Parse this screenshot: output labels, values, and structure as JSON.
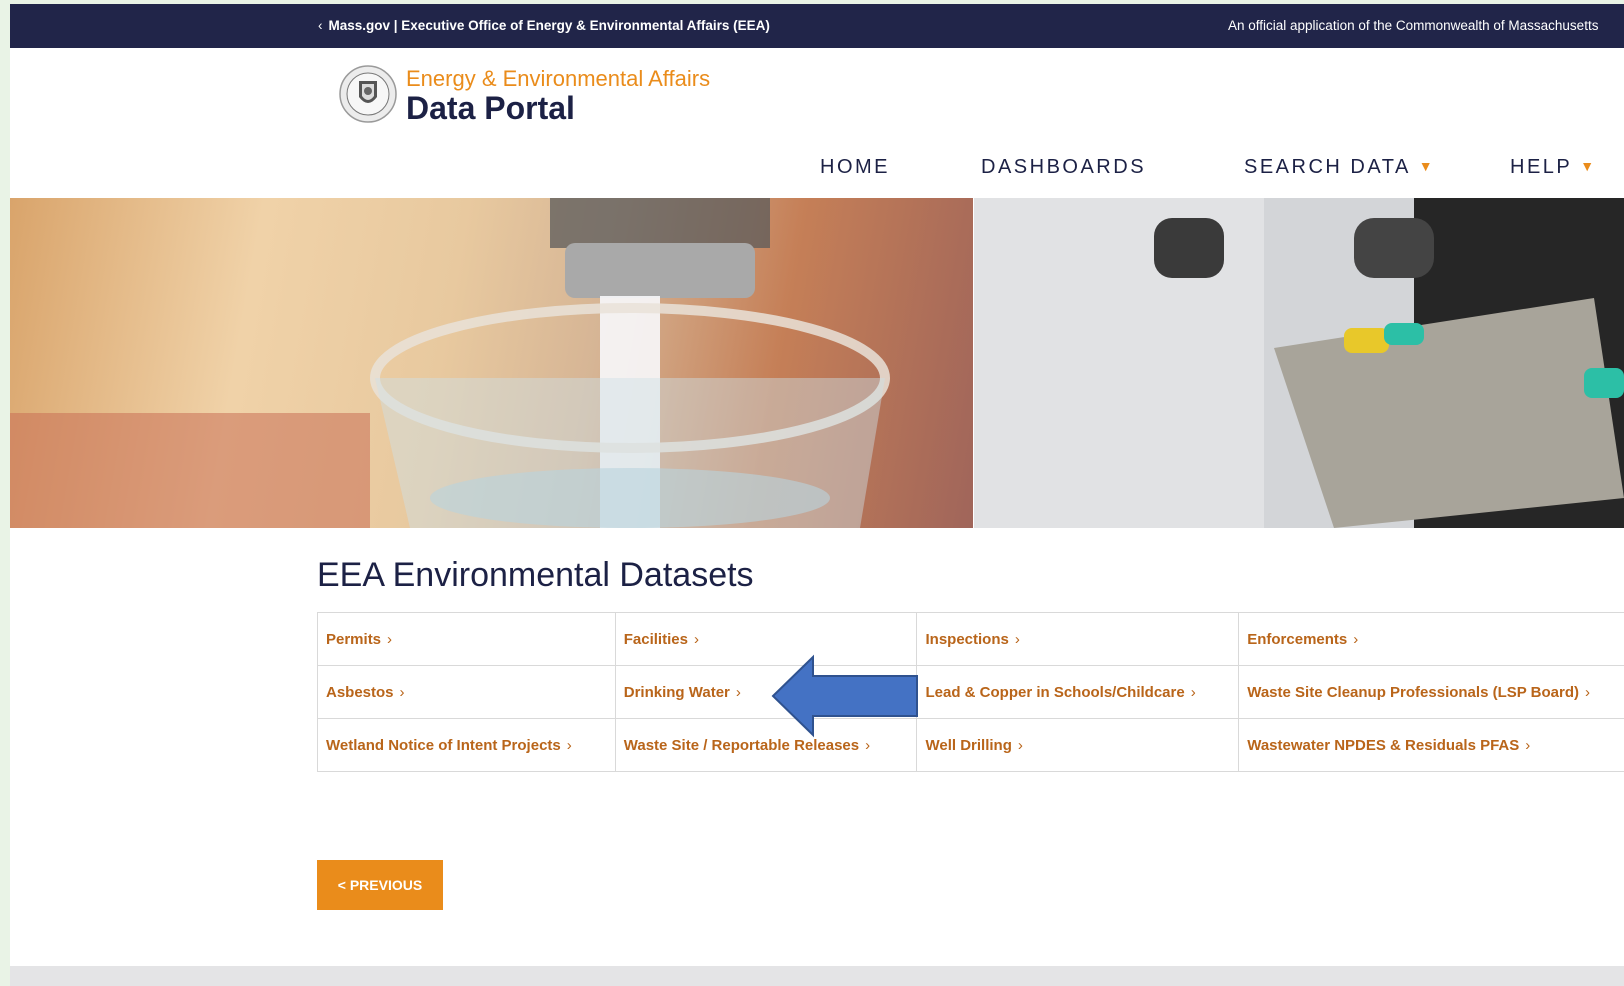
{
  "topbar": {
    "back_label": "Mass.gov | Executive Office of Energy & Environmental Affairs (EEA)",
    "official_text": "An official application of the Commonwealth of Massachusetts"
  },
  "brand": {
    "subtitle": "Energy & Environmental Affairs",
    "title": "Data Portal"
  },
  "nav": {
    "home": "HOME",
    "dashboards": "DASHBOARDS",
    "search_data": "SEARCH DATA",
    "help": "HELP"
  },
  "main": {
    "heading": "EEA Environmental Datasets",
    "datasets": [
      [
        "Permits",
        "Facilities",
        "Inspections",
        "Enforcements"
      ],
      [
        "Asbestos",
        "Drinking Water",
        "Lead & Copper in Schools/Childcare",
        "Waste Site Cleanup Professionals (LSP Board)"
      ],
      [
        "Wetland Notice of Intent Projects",
        "Waste Site / Reportable Releases",
        "Well Drilling",
        "Wastewater NPDES & Residuals PFAS"
      ]
    ],
    "previous_label": "< PREVIOUS"
  },
  "colors": {
    "navy": "#212549",
    "accent_orange": "#ea8c1b",
    "link_orange": "#b9651a",
    "annotation_arrow": "#4472c4"
  },
  "icons": [
    "chevron-left-icon",
    "commonwealth-seal-logo",
    "chevron-down-icon",
    "chevron-right-icon",
    "annotation-arrow-icon"
  ]
}
